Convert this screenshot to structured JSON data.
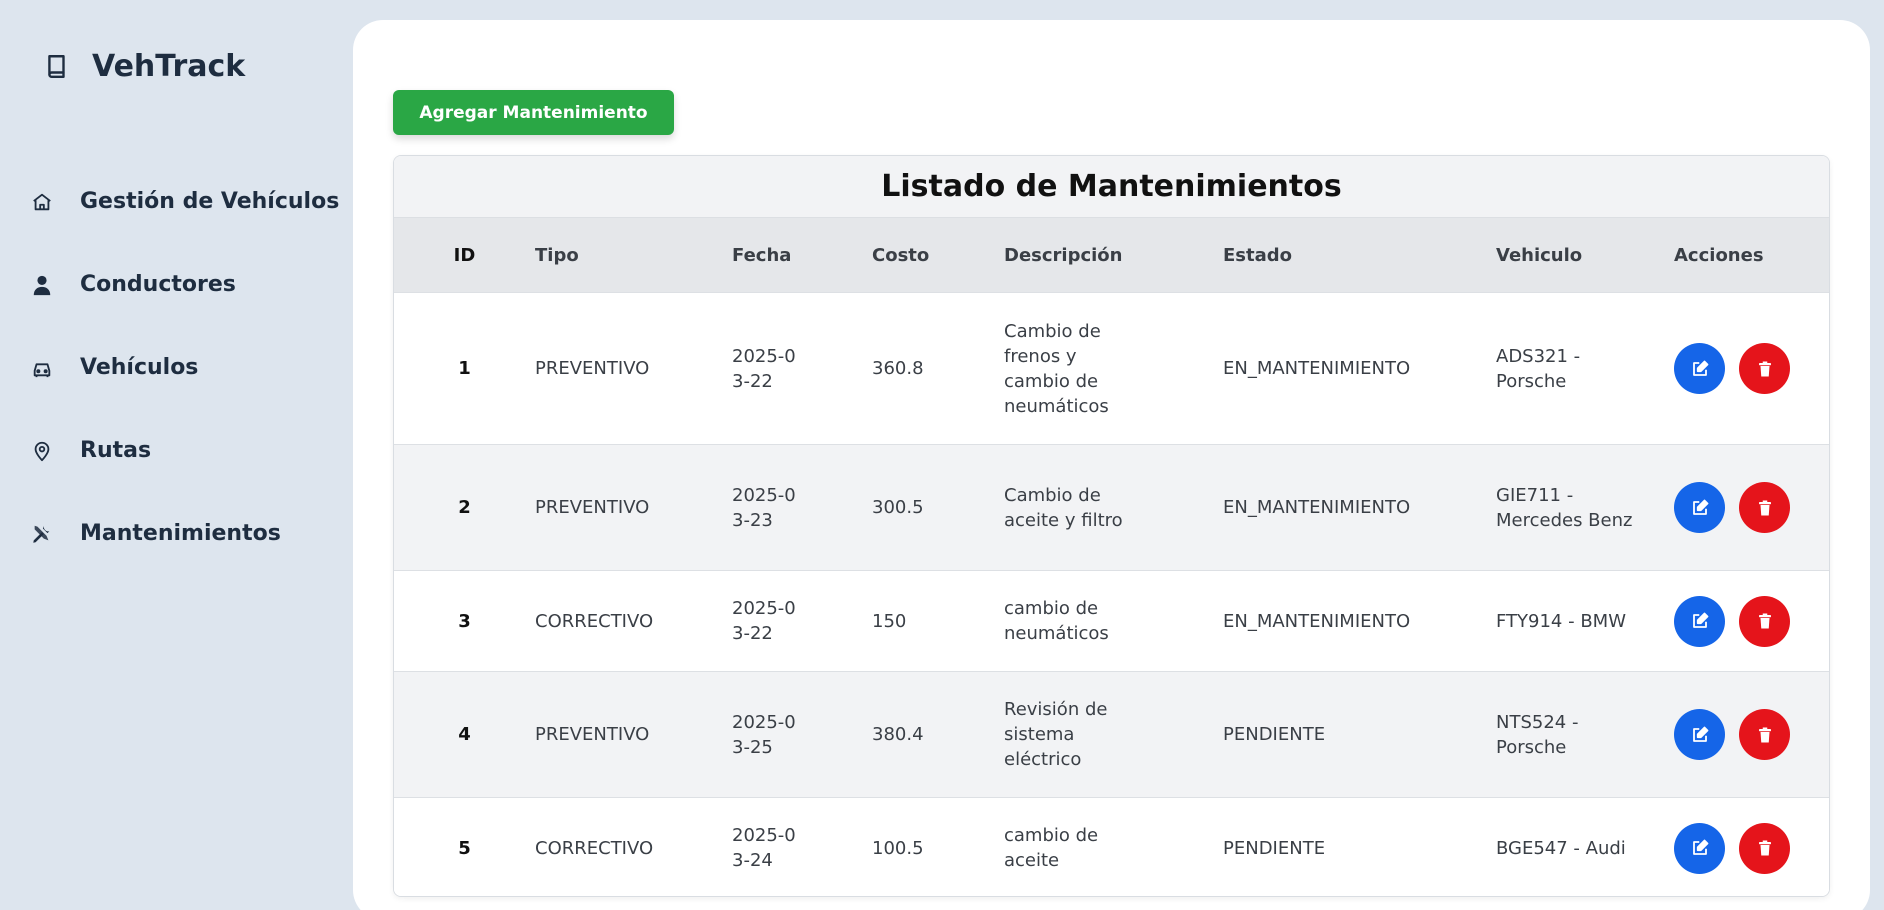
{
  "brand": {
    "title": "VehTrack",
    "icon": "book-icon"
  },
  "nav": [
    {
      "label": "Gestión de Vehículos",
      "icon": "home-icon"
    },
    {
      "label": "Conductores",
      "icon": "user-icon"
    },
    {
      "label": "Vehículos",
      "icon": "car-icon"
    },
    {
      "label": "Rutas",
      "icon": "map-pin-icon"
    },
    {
      "label": "Mantenimientos",
      "icon": "tools-icon"
    }
  ],
  "toolbar": {
    "add_label": "Agregar Mantenimiento"
  },
  "table": {
    "title": "Listado de Mantenimientos",
    "headers": [
      "ID",
      "Tipo",
      "Fecha",
      "Costo",
      "Descripción",
      "Estado",
      "Vehiculo",
      "Acciones"
    ],
    "rows": [
      {
        "id": "1",
        "tipo": "PREVENTIVO",
        "fecha": "2025-03-22",
        "costo": "360.8",
        "descripcion": "Cambio de frenos y cambio de neumáticos",
        "estado": "EN_MANTENIMIENTO",
        "vehiculo": "ADS321 - Porsche"
      },
      {
        "id": "2",
        "tipo": "PREVENTIVO",
        "fecha": "2025-03-23",
        "costo": "300.5",
        "descripcion": "Cambio de aceite y filtro",
        "estado": "EN_MANTENIMIENTO",
        "vehiculo": "GIE711 - Mercedes Benz"
      },
      {
        "id": "3",
        "tipo": "CORRECTIVO",
        "fecha": "2025-03-22",
        "costo": "150",
        "descripcion": "cambio de neumáticos",
        "estado": "EN_MANTENIMIENTO",
        "vehiculo": "FTY914 - BMW"
      },
      {
        "id": "4",
        "tipo": "PREVENTIVO",
        "fecha": "2025-03-25",
        "costo": "380.4",
        "descripcion": "Revisión de sistema eléctrico",
        "estado": "PENDIENTE",
        "vehiculo": "NTS524 - Porsche"
      },
      {
        "id": "5",
        "tipo": "CORRECTIVO",
        "fecha": "2025-03-24",
        "costo": "100.5",
        "descripcion": "cambio de aceite",
        "estado": "PENDIENTE",
        "vehiculo": "BGE547 - Audi"
      }
    ]
  },
  "actions": {
    "edit_icon": "edit-icon",
    "delete_icon": "trash-icon"
  },
  "colors": {
    "sidebar_bg": "#dde5ee",
    "add_button": "#2aa745",
    "edit_button": "#1565e8",
    "delete_button": "#e5141b"
  }
}
